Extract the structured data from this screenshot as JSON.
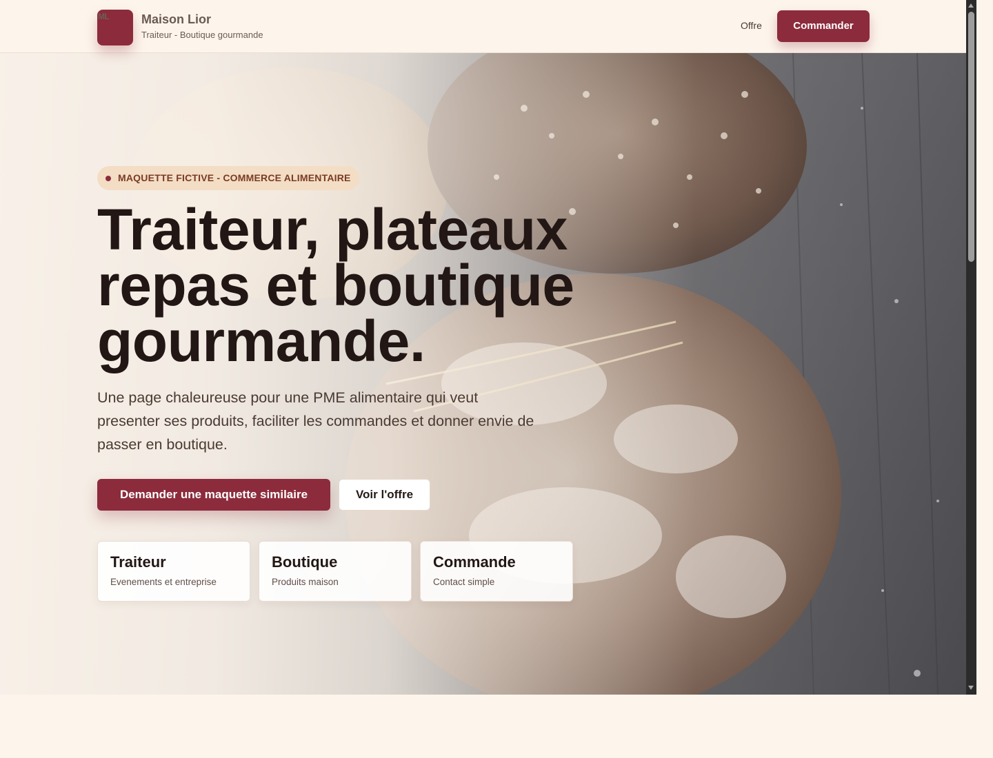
{
  "header": {
    "logo_initials": "ML",
    "brand_name": "Maison Lior",
    "brand_subtitle": "Traiteur - Boutique gourmande",
    "nav_offer": "Offre",
    "order_button": "Commander"
  },
  "hero": {
    "tag": "MAQUETTE FICTIVE - COMMERCE ALIMENTAIRE",
    "headline_lines": [
      "Traiteur, plateaux",
      "repas et boutique",
      "gourmande."
    ],
    "lead": "Une page chaleureuse pour une PME alimentaire qui veut presenter ses produits, faciliter les commandes et donner envie de passer en boutique.",
    "primary_button": "Demander une maquette similaire",
    "secondary_button": "Voir l'offre",
    "cards": [
      {
        "title": "Traiteur",
        "subtitle": "Evenements et entreprise"
      },
      {
        "title": "Boutique",
        "subtitle": "Produits maison"
      },
      {
        "title": "Commande",
        "subtitle": "Contact simple"
      }
    ]
  },
  "colors": {
    "accent": "#8c2b3b",
    "background": "#fdf5ec",
    "tag_background": "#f3ddc5",
    "heading": "#221714"
  },
  "icons": {
    "hero_image": "bread-loaves-photo",
    "tag_marker": "dot-icon"
  }
}
